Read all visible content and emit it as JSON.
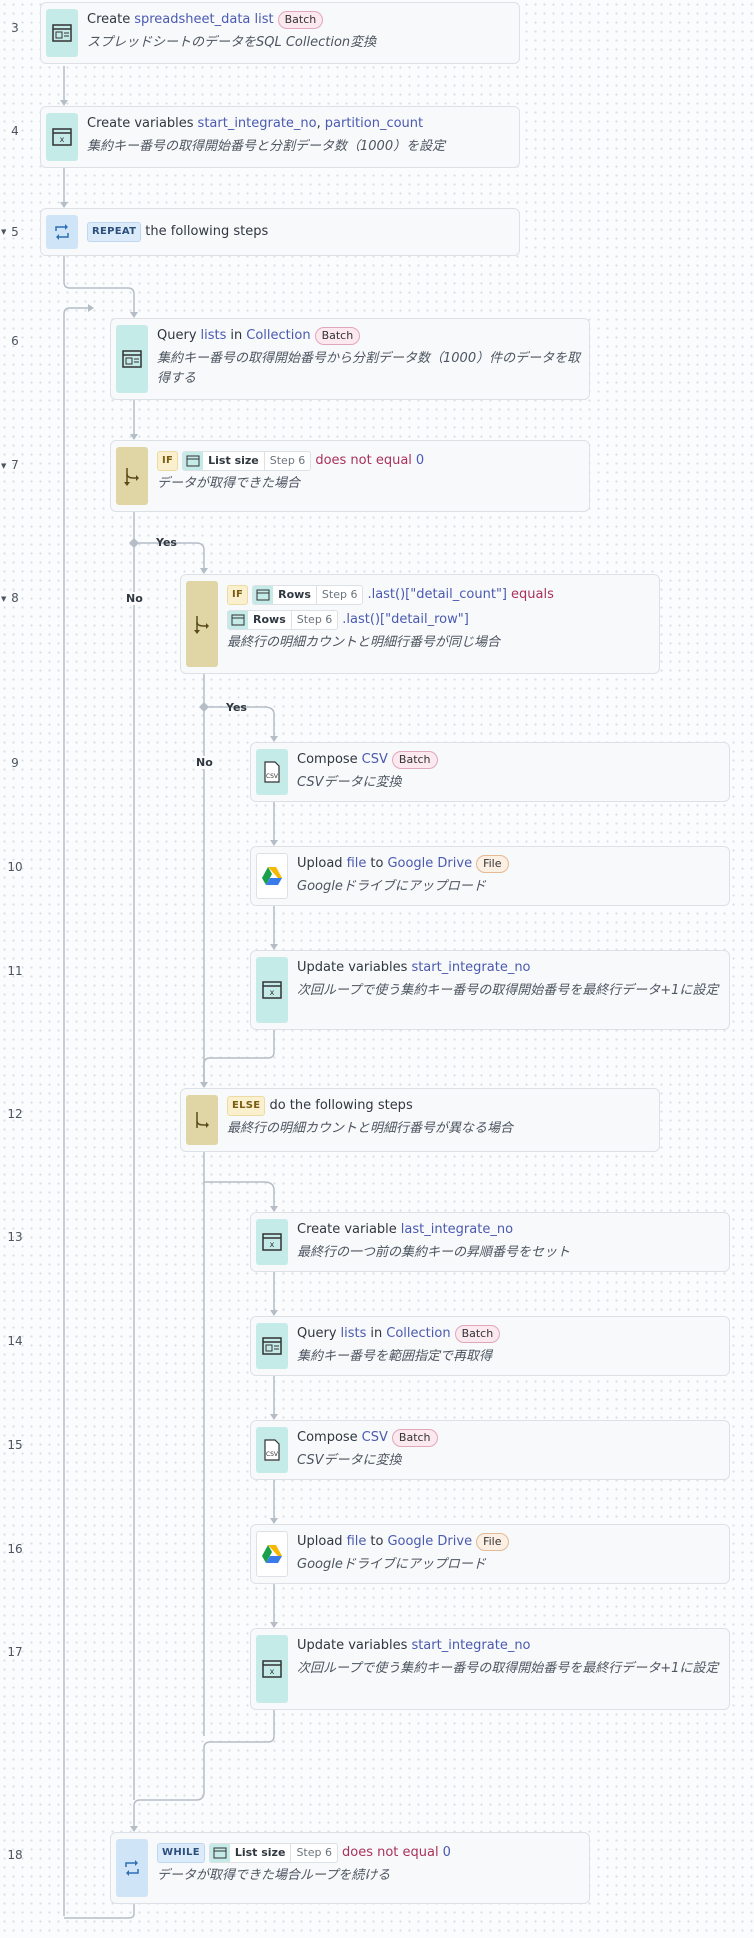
{
  "colors": {
    "accent": "#4a5ab0",
    "condition": "#a8325a",
    "teal_icon": "#c5ebe8",
    "cond_icon": "#e0d5a4",
    "repeat_icon": "#cfe5f7"
  },
  "branch_labels": {
    "yes": "Yes",
    "no": "No"
  },
  "steps": {
    "s3": {
      "num": "3",
      "word": "Create",
      "var": "spreadsheet_data list",
      "badge": "Batch",
      "desc": "スプレッドシートのデータをSQL Collection変換"
    },
    "s4": {
      "num": "4",
      "word": "Create variables",
      "var1": "start_integrate_no",
      "sep": ",",
      "var2": "partition_count",
      "desc": "集約キー番号の取得開始番号と分割データ数（1000）を設定"
    },
    "s5": {
      "num": "5",
      "kw": "REPEAT",
      "text": "the following steps"
    },
    "s6": {
      "num": "6",
      "word": "Query",
      "obj": "lists",
      "in": "in",
      "src": "Collection",
      "badge": "Batch",
      "desc": "集約キー番号の取得開始番号から分割データ数（1000）件のデータを取得する"
    },
    "s7": {
      "num": "7",
      "kw": "IF",
      "pill": "List size",
      "pill_step": "Step 6",
      "cond": "does not equal",
      "val": "0",
      "desc": "データが取得できた場合"
    },
    "s8": {
      "num": "8",
      "kw": "IF",
      "pill": "Rows",
      "pill_step": "Step 6",
      "expr1": ".last()[\"detail_count\"]",
      "cond": "equals",
      "pill2": "Rows",
      "pill2_step": "Step 6",
      "expr2": ".last()[\"detail_row\"]",
      "desc": "最終行の明細カウントと明細行番号が同じ場合"
    },
    "s9": {
      "num": "9",
      "word": "Compose",
      "obj": "CSV",
      "badge": "Batch",
      "desc": "CSVデータに変換"
    },
    "s10": {
      "num": "10",
      "word": "Upload",
      "obj": "file",
      "to": "to",
      "dest": "Google Drive",
      "badge": "File",
      "desc": "Googleドライブにアップロード"
    },
    "s11": {
      "num": "11",
      "word": "Update variables",
      "var": "start_integrate_no",
      "desc": "次回ループで使う集約キー番号の取得開始番号を最終行データ+1に設定"
    },
    "s12": {
      "num": "12",
      "kw": "ELSE",
      "text": "do the following steps",
      "desc": "最終行の明細カウントと明細行番号が異なる場合"
    },
    "s13": {
      "num": "13",
      "word": "Create variable",
      "var": "last_integrate_no",
      "desc": "最終行の一つ前の集約キーの昇順番号をセット"
    },
    "s14": {
      "num": "14",
      "word": "Query",
      "obj": "lists",
      "in": "in",
      "src": "Collection",
      "badge": "Batch",
      "desc": "集約キー番号を範囲指定で再取得"
    },
    "s15": {
      "num": "15",
      "word": "Compose",
      "obj": "CSV",
      "badge": "Batch",
      "desc": "CSVデータに変換"
    },
    "s16": {
      "num": "16",
      "word": "Upload",
      "obj": "file",
      "to": "to",
      "dest": "Google Drive",
      "badge": "File",
      "desc": "Googleドライブにアップロード"
    },
    "s17": {
      "num": "17",
      "word": "Update variables",
      "var": "start_integrate_no",
      "desc": "次回ループで使う集約キー番号の取得開始番号を最終行データ+1に設定"
    },
    "s18": {
      "num": "18",
      "kw": "WHILE",
      "pill": "List size",
      "pill_step": "Step 6",
      "cond": "does not equal",
      "val": "0",
      "desc": "データが取得できた場合ループを続ける"
    }
  }
}
